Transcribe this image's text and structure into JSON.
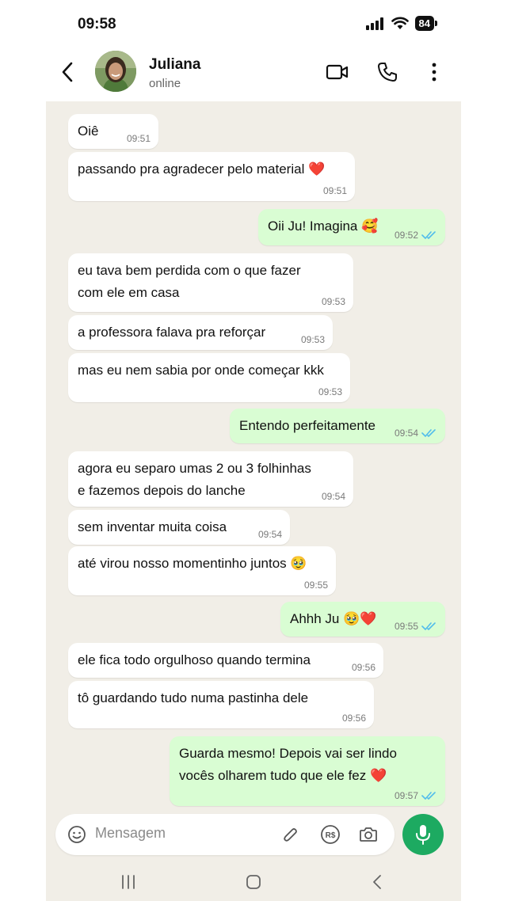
{
  "status_bar": {
    "time": "09:58",
    "battery": "84"
  },
  "header": {
    "contact_name": "Juliana",
    "contact_status": "online"
  },
  "messages": [
    {
      "dir": "in",
      "text": "Oiê",
      "time": "09:51"
    },
    {
      "dir": "in",
      "text": "passando pra agradecer pelo material ❤️",
      "time": "09:51"
    },
    {
      "dir": "out",
      "text": "Oii Ju! Imagina 🥰",
      "time": "09:52",
      "read": true
    },
    {
      "dir": "in",
      "text": "eu tava bem perdida com o que fazer\ncom ele em casa",
      "time": "09:53"
    },
    {
      "dir": "in",
      "text": "a professora falava pra reforçar",
      "time": "09:53"
    },
    {
      "dir": "in",
      "text": "mas eu nem sabia por onde começar kkk",
      "time": "09:53"
    },
    {
      "dir": "out",
      "text": "Entendo perfeitamente",
      "time": "09:54",
      "read": true
    },
    {
      "dir": "in",
      "text": "agora eu separo umas 2 ou 3 folhinhas\ne fazemos depois do lanche",
      "time": "09:54"
    },
    {
      "dir": "in",
      "text": "sem inventar muita coisa",
      "time": "09:54"
    },
    {
      "dir": "in",
      "text": "até virou nosso momentinho juntos 🥹",
      "time": "09:55"
    },
    {
      "dir": "out",
      "text": "Ahhh Ju 🥹❤️",
      "time": "09:55",
      "read": true
    },
    {
      "dir": "in",
      "text": "ele fica todo orgulhoso quando termina",
      "time": "09:56"
    },
    {
      "dir": "in",
      "text": "tô guardando tudo numa pastinha dele",
      "time": "09:56"
    },
    {
      "dir": "out",
      "text": "Guarda mesmo! Depois vai ser lindo\nvocês olharem tudo que ele fez ❤️",
      "time": "09:57",
      "read": true
    }
  ],
  "composer": {
    "placeholder": "Mensagem"
  },
  "colors": {
    "incoming": "#ffffff",
    "outgoing": "#d9fdd3",
    "background": "#f1eee7",
    "read_ticks": "#53bdeb",
    "mic": "#1daa61"
  },
  "icons": [
    "back-arrow",
    "video-call",
    "voice-call",
    "more-vertical",
    "emoji",
    "attach-clip",
    "payment-rs",
    "camera",
    "mic",
    "nav-recents",
    "nav-home",
    "nav-back"
  ]
}
